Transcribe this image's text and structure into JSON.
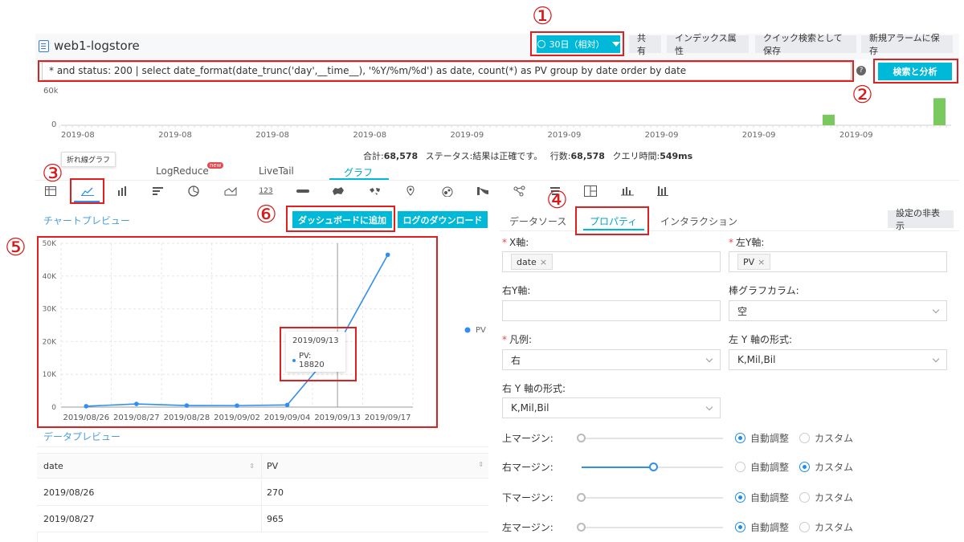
{
  "header": {
    "title": "web1-logstore",
    "time_range": "30日（相対）",
    "share": "共有",
    "index_attr": "インデックス属性",
    "save_quick": "クイック検索として保存",
    "save_alarm": "新規アラームに保存"
  },
  "query": {
    "text": "* and status: 200 | select date_format(date_trunc('day',__time__), '%Y/%m/%d') as date, count(*) as PV group by date order by date",
    "search_button": "検索と分析",
    "help": "?"
  },
  "histogram": {
    "y_top": "60k",
    "y_bottom": "0",
    "x_labels": [
      "2019-08",
      "2019-08",
      "2019-08",
      "2019-08",
      "2019-09",
      "2019-09",
      "2019-09",
      "2019-09",
      "2019-09"
    ],
    "bars": [
      {
        "value": 18000
      },
      {
        "value": 46000
      }
    ],
    "status_line": {
      "total_label": "合計:",
      "total": "68,578",
      "status_label": "ステータス:",
      "status": "結果は正確です。",
      "rows_label": "行数:",
      "rows": "68,578",
      "time_label": "クエリ時間:",
      "time": "549ms"
    }
  },
  "tabs": {
    "tooltip": "折れ線グラフ",
    "items": [
      "LogReduce",
      "LiveTail",
      "グラフ"
    ],
    "new_badge": "new"
  },
  "chart_icons": [
    "table-icon",
    "line-chart-icon",
    "bar-chart-icon",
    "horizontal-bar-icon",
    "pie-chart-icon",
    "area-chart-icon",
    "number-icon",
    "progress-icon",
    "map-icon",
    "world-map-icon",
    "location-icon",
    "bubble-icon",
    "flow-icon",
    "sankey-icon",
    "wordcloud-icon",
    "treemap-icon",
    "cross-table-icon",
    "column-icon"
  ],
  "chart_icon_text": {
    "number": "123"
  },
  "preview": {
    "title": "チャートプレビュー",
    "add_dashboard": "ダッシュボードに追加",
    "download_log": "ログのダウンロード",
    "data_preview": "データプレビュー"
  },
  "chart_data": {
    "type": "line",
    "categories": [
      "2019/08/26",
      "2019/08/27",
      "2019/08/28",
      "2019/09/02",
      "2019/09/04",
      "2019/09/13",
      "2019/09/17"
    ],
    "series": [
      {
        "name": "PV",
        "values": [
          270,
          965,
          480,
          460,
          650,
          18820,
          46500
        ]
      }
    ],
    "ylim": [
      0,
      50000
    ],
    "yticks": [
      "0",
      "10K",
      "20K",
      "30K",
      "40K",
      "50K"
    ],
    "legend": "right",
    "grid": true,
    "tooltip": {
      "date": "2019/09/13",
      "label": "PV: 18820"
    }
  },
  "table": {
    "headers": [
      "date",
      "PV"
    ],
    "rows": [
      [
        "2019/08/26",
        "270"
      ],
      [
        "2019/08/27",
        "965"
      ]
    ]
  },
  "panel": {
    "tabs": [
      "データソース",
      "プロパティ",
      "インタラクション"
    ],
    "hide_settings": "設定の非表示",
    "x_axis_label": "X軸:",
    "x_axis_tag": "date",
    "left_y_label": "左Y軸:",
    "left_y_tag": "PV",
    "right_y_label": "右Y軸:",
    "bar_column_label": "棒グラフカラム:",
    "bar_column_value": "空",
    "legend_label": "凡例:",
    "legend_value": "右",
    "left_y_format_label": "左 Y 軸の形式:",
    "left_y_format_value": "K,Mil,Bil",
    "right_y_format_label": "右 Y 軸の形式:",
    "right_y_format_value": "K,Mil,Bil",
    "margins": [
      {
        "label": "上マージン:",
        "level": 0,
        "mode": "auto"
      },
      {
        "label": "右マージン:",
        "level": 0.6,
        "mode": "custom"
      },
      {
        "label": "下マージン:",
        "level": 0,
        "mode": "auto"
      },
      {
        "label": "左マージン:",
        "level": 0,
        "mode": "auto"
      }
    ],
    "auto_label": "自動調整",
    "custom_label": "カスタム"
  },
  "annotations": [
    "①",
    "②",
    "③",
    "④",
    "⑤",
    "⑥"
  ],
  "colors": {
    "accent": "#00b9d9",
    "line": "#2f8ff0",
    "annotation": "#e02020"
  }
}
